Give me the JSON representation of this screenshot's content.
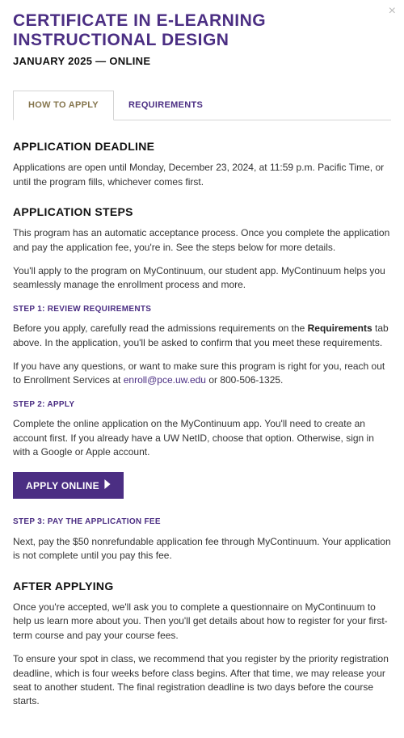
{
  "close_label": "×",
  "title": "CERTIFICATE IN E-LEARNING INSTRUCTIONAL DESIGN",
  "subtitle": "JANUARY 2025 — ONLINE",
  "tabs": [
    {
      "label": "HOW TO APPLY",
      "active": true
    },
    {
      "label": "REQUIREMENTS",
      "active": false
    }
  ],
  "sections": {
    "deadline": {
      "heading": "APPLICATION DEADLINE",
      "body": "Applications are open until Monday, December 23, 2024, at 11:59 p.m. Pacific Time, or until the program fills, whichever comes first."
    },
    "steps": {
      "heading": "APPLICATION STEPS",
      "intro1": "This program has an automatic acceptance process. Once you complete the application and pay the application fee, you're in. See the steps below for more details.",
      "intro2": "You'll apply to the program on MyContinuum, our student app. MyContinuum helps you seamlessly manage the enrollment process and more.",
      "step1": {
        "heading": "STEP 1: REVIEW REQUIREMENTS",
        "p1a": "Before you apply, carefully read the admissions requirements on the ",
        "p1b_strong": "Requirements",
        "p1c": " tab above. In the application, you'll be asked to confirm that you meet these requirements.",
        "p2a": "If you have any questions, or want to make sure this program is right for you, reach out to Enrollment Services at ",
        "p2link": "enroll@pce.uw.edu",
        "p2b": " or 800-506-1325."
      },
      "step2": {
        "heading": "STEP 2: APPLY",
        "p1": "Complete the online application on the MyContinuum app. You'll need to create an account first. If you already have a UW NetID, choose that option. Otherwise, sign in with a Google or Apple account.",
        "button": "APPLY ONLINE"
      },
      "step3": {
        "heading": "STEP 3: PAY THE APPLICATION FEE",
        "p1": "Next, pay the $50 nonrefundable application fee through MyContinuum. Your application is not complete until you pay this fee."
      }
    },
    "after": {
      "heading": "AFTER APPLYING",
      "p1": "Once you're accepted, we'll ask you to complete a questionnaire on MyContinuum to help us learn more about you. Then you'll get details about how to register for your first-term course and pay your course fees.",
      "p2": "To ensure your spot in class, we recommend that you register by the priority registration deadline, which is four weeks before class begins. After that time, we may release your seat to another student. The final registration deadline is two days before the course starts."
    }
  }
}
